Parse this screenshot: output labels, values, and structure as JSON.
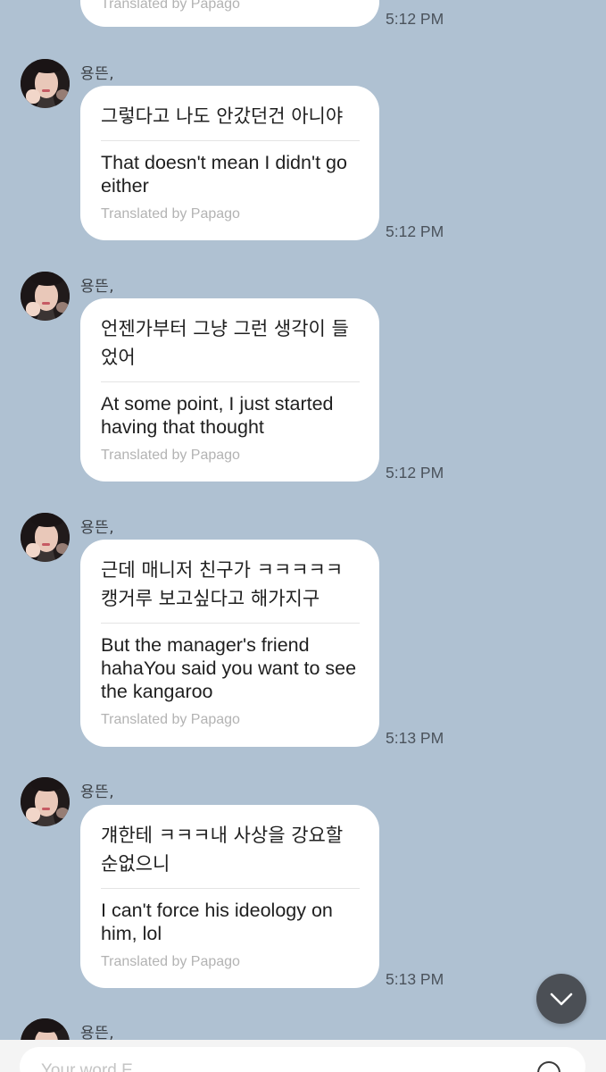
{
  "messages": [
    {
      "sender": "",
      "original": "",
      "translation": "",
      "credit": "Translated by Papago",
      "time": "5:12 PM"
    },
    {
      "sender": "용뜬,",
      "original": "그렇다고 나도 안갔던건 아니야",
      "translation": "That doesn't mean I didn't go either",
      "credit": "Translated by Papago",
      "time": "5:12 PM"
    },
    {
      "sender": "용뜬,",
      "original": "언젠가부터 그냥 그런 생각이 들었어",
      "translation": "At some point, I just started having that thought",
      "credit": "Translated by Papago",
      "time": "5:12 PM"
    },
    {
      "sender": "용뜬,",
      "original": "근데 매니저 친구가 ㅋㅋㅋㅋㅋ 캥거루 보고싶다고 해가지구",
      "translation": "But the manager's friend hahaYou said you want to see the kangaroo",
      "credit": "Translated by Papago",
      "time": "5:13 PM"
    },
    {
      "sender": "용뜬,",
      "original": "걔한테 ㅋㅋㅋ내 사상을 강요할 순없으니",
      "translation": "I can't force his ideology on him, lol",
      "credit": "Translated by Papago",
      "time": "5:13 PM"
    },
    {
      "sender": "용뜬,"
    }
  ],
  "composer": {
    "placeholder": "Your word E..."
  },
  "icons": {
    "scroll": "chevron-down-icon",
    "emoji": "emoji-icon"
  }
}
